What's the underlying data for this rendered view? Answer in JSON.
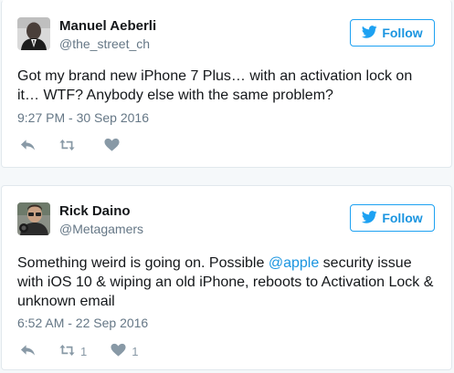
{
  "tweets": [
    {
      "name": "Manuel Aeberli",
      "handle": "@the_street_ch",
      "follow_label": "Follow",
      "text_lines": [
        "Got my brand new iPhone 7 Plus… with an activation lock on",
        "it… WTF? Anybody else with the same problem?"
      ],
      "timestamp": "9:27 PM - 30 Sep 2016",
      "retweet_count": "",
      "like_count": ""
    },
    {
      "name": "Rick Daino",
      "handle": "@Metagamers",
      "follow_label": "Follow",
      "text_line1_before": "Something weird is going on. Possible ",
      "text_line1_mention": "@apple",
      "text_line1_after": " security issue",
      "text_line2": "with iOS 10 & wiping an old iPhone, reboots to Activation Lock &",
      "text_line3": "unknown email",
      "timestamp": "6:52 AM - 22 Sep 2016",
      "retweet_count": "1",
      "like_count": "1"
    }
  ],
  "colors": {
    "accent": "#1da1f2",
    "link": "#1b95e0",
    "muted": "#657786",
    "icon": "#8899a6"
  },
  "icons": [
    "bird-icon",
    "reply-icon",
    "retweet-icon",
    "heart-icon"
  ]
}
